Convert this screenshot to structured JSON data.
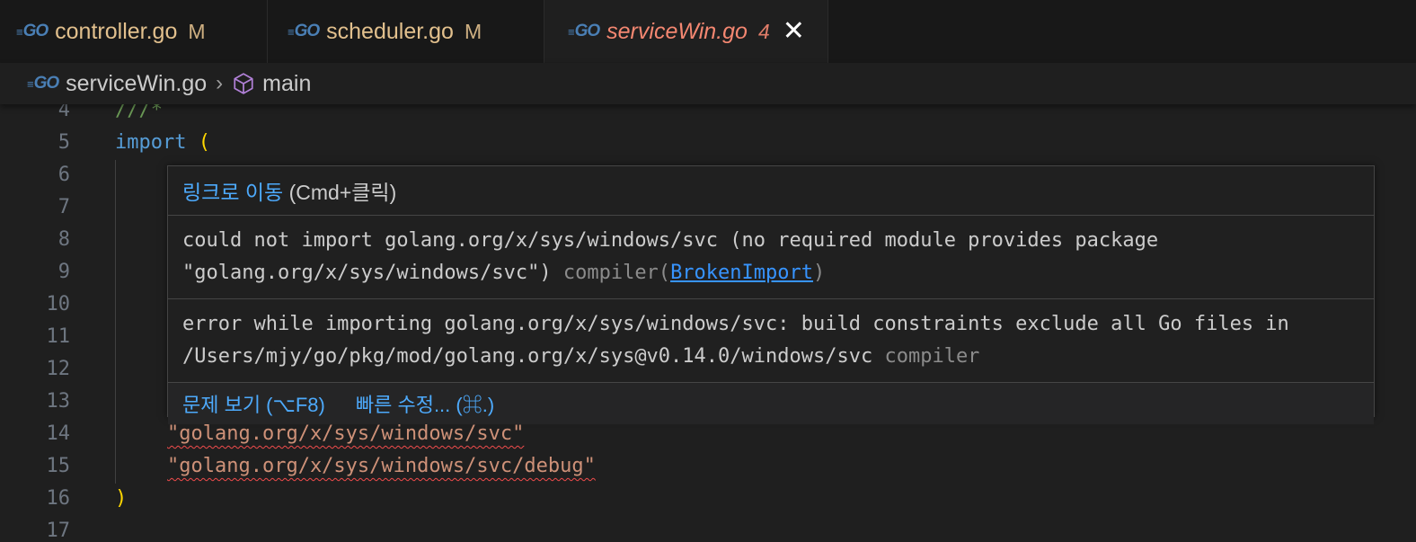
{
  "tabs": [
    {
      "name": "controller.go",
      "badge": "M"
    },
    {
      "name": "scheduler.go",
      "badge": "M"
    },
    {
      "name": "serviceWin.go",
      "badge": "4",
      "close": "✕"
    }
  ],
  "go_icon_text": "GO",
  "breadcrumb": {
    "file": "serviceWin.go",
    "separator": "›",
    "symbol": "main"
  },
  "editor": {
    "line_numbers": [
      "4",
      "5",
      "6",
      "7",
      "8",
      "9",
      "10",
      "11",
      "12",
      "13",
      "14",
      "15",
      "16",
      "17"
    ],
    "line4": "///*",
    "line5_kw": "import",
    "line5_paren": "(",
    "line14": "\"golang.org/x/sys/windows/svc\"",
    "line15": "\"golang.org/x/sys/windows/svc/debug\"",
    "line16": ")"
  },
  "hover": {
    "goto_link": "링크로 이동",
    "goto_shortcut": "(Cmd+클릭)",
    "error1": "could not import golang.org/x/sys/windows/svc (no required module provides package \"golang.org/x/sys/windows/svc\") ",
    "error1_source": "compiler(",
    "error1_code": "BrokenImport",
    "error1_close": ")",
    "error2": "error while importing golang.org/x/sys/windows/svc: build constraints exclude all Go files in /Users/mjy/go/pkg/mod/golang.org/x/sys@v0.14.0/windows/svc ",
    "error2_source": "compiler",
    "action_view_problem": "문제 보기 (⌥F8)",
    "action_quick_fix": "빠른 수정... (⌘.)"
  },
  "colors": {
    "modified": "#e2c08d",
    "error_tab": "#f48771",
    "link": "#4daafc",
    "keyword": "#569cd6",
    "string": "#ce9178"
  }
}
